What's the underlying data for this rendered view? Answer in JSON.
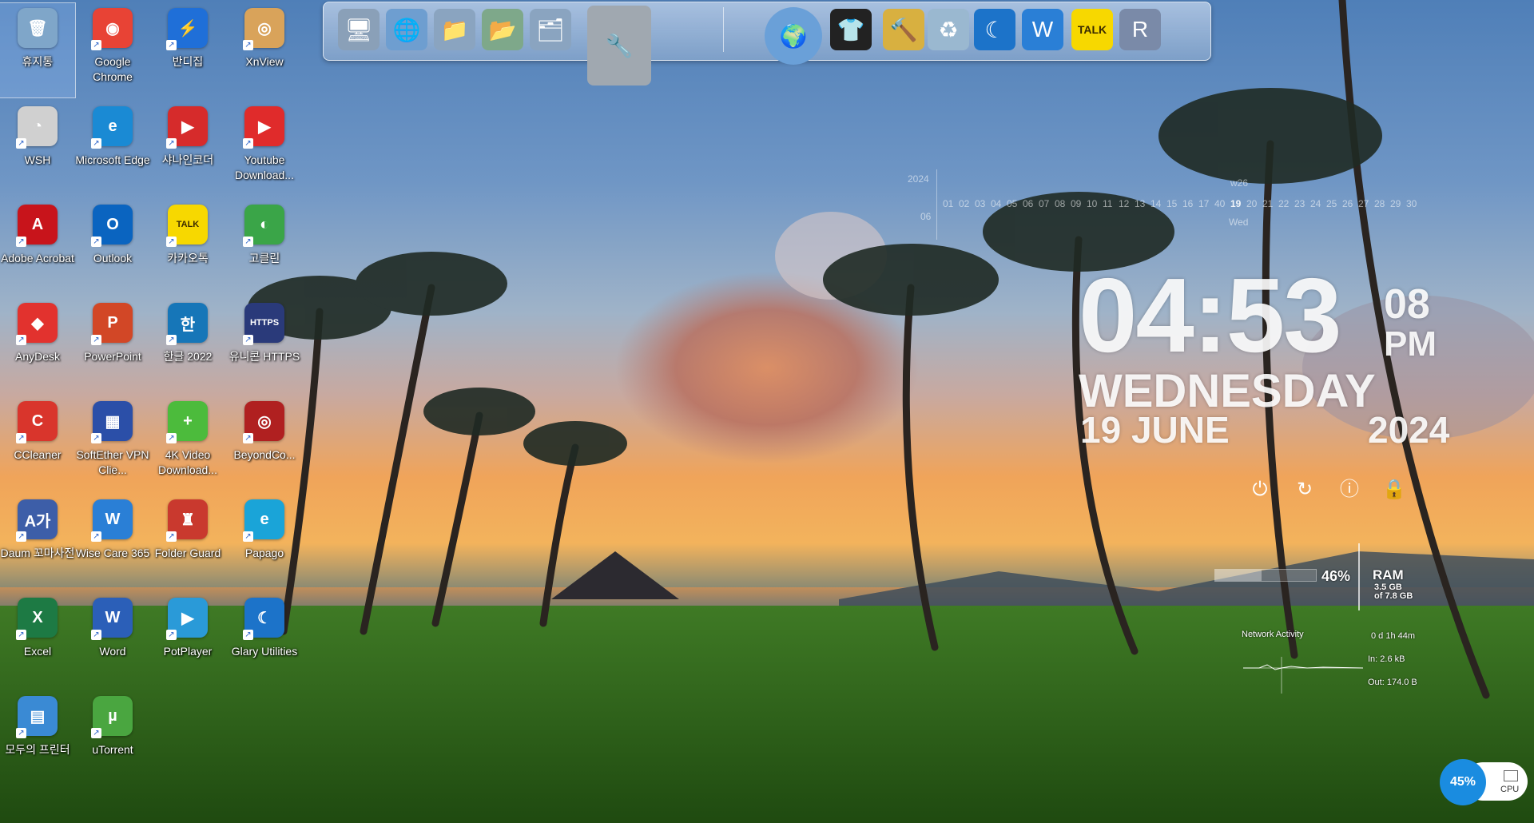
{
  "desktop": {
    "icons": [
      {
        "label": "휴지통",
        "color": "#7fa6c9",
        "glyph": "🗑"
      },
      {
        "label": "Google Chrome",
        "color": "#e84335",
        "glyph": "◉"
      },
      {
        "label": "반디집",
        "color": "#1f6fd8",
        "glyph": "⚡"
      },
      {
        "label": "XnView",
        "color": "#d9a35a",
        "glyph": "◎"
      },
      {
        "label": "WSH",
        "color": "#d0d0d0",
        "glyph": "◔"
      },
      {
        "label": "Microsoft Edge",
        "color": "#1a8ad4",
        "glyph": "e"
      },
      {
        "label": "샤나인코더",
        "color": "#d62b2b",
        "glyph": "▶"
      },
      {
        "label": "Youtube Download...",
        "color": "#e02b2b",
        "glyph": "▶"
      },
      {
        "label": "Adobe Acrobat",
        "color": "#c8141b",
        "glyph": "A"
      },
      {
        "label": "Outlook",
        "color": "#0a64c0",
        "glyph": "O"
      },
      {
        "label": "카카오톡",
        "color": "#f7d800",
        "glyph": "TALK"
      },
      {
        "label": "고클린",
        "color": "#3aa548",
        "glyph": "◐"
      },
      {
        "label": "AnyDesk",
        "color": "#e2322e",
        "glyph": "◆"
      },
      {
        "label": "PowerPoint",
        "color": "#d24726",
        "glyph": "P"
      },
      {
        "label": "한글 2022",
        "color": "#1676b8",
        "glyph": "한"
      },
      {
        "label": "유니콘 HTTPS",
        "color": "#2a3a7a",
        "glyph": "HTTPS"
      },
      {
        "label": "CCleaner",
        "color": "#d9352c",
        "glyph": "C"
      },
      {
        "label": "SoftEther VPN Clie...",
        "color": "#2b4fa8",
        "glyph": "▦"
      },
      {
        "label": "4K Video Download...",
        "color": "#4cbb3c",
        "glyph": "+"
      },
      {
        "label": "BeyondCo...",
        "color": "#b02020",
        "glyph": "◎"
      },
      {
        "label": "Daum 꼬마사전",
        "color": "#3d5ea8",
        "glyph": "A가"
      },
      {
        "label": "Wise Care 365",
        "color": "#2a7fd6",
        "glyph": "W"
      },
      {
        "label": "Folder Guard",
        "color": "#c9392e",
        "glyph": "♜"
      },
      {
        "label": "Papago",
        "color": "#1aa4d8",
        "glyph": "e"
      },
      {
        "label": "Excel",
        "color": "#1d7a44",
        "glyph": "X"
      },
      {
        "label": "Word",
        "color": "#2b5fb8",
        "glyph": "W"
      },
      {
        "label": "PotPlayer",
        "color": "#2a9ad8",
        "glyph": "▶"
      },
      {
        "label": "Glary Utilities",
        "color": "#1c73c9",
        "glyph": "☾"
      },
      {
        "label": "모두의 프린터",
        "color": "#3a8ad4",
        "glyph": "▤"
      },
      {
        "label": "uTorrent",
        "color": "#4aa640",
        "glyph": "µ"
      }
    ]
  },
  "dock": {
    "items": [
      {
        "name": "computer-icon",
        "glyph": "🖥",
        "color": "#8aa0b8"
      },
      {
        "name": "network-icon",
        "glyph": "🌐",
        "color": "#6e9ed0"
      },
      {
        "name": "folder-icon",
        "glyph": "📁",
        "color": "#8aa4c0"
      },
      {
        "name": "folder-green-icon",
        "glyph": "📂",
        "color": "#7ea88a"
      },
      {
        "name": "folder-open-icon",
        "glyph": "🗂",
        "color": "#8aa4c0"
      },
      {
        "name": "tools-icon",
        "glyph": "🔧",
        "color": "#a0a8b0"
      },
      {
        "name": "globe-icon",
        "glyph": "🌍",
        "color": "#6aa0d8"
      },
      {
        "name": "tshirt-icon",
        "glyph": "👕",
        "color": "#222222"
      },
      {
        "name": "hammer-icon",
        "glyph": "🔨",
        "color": "#d8b040"
      },
      {
        "name": "recycle-bin-icon",
        "glyph": "♻",
        "color": "#9ab8d0"
      },
      {
        "name": "glary-icon",
        "glyph": "☾",
        "color": "#1c73c9"
      },
      {
        "name": "wise-icon",
        "glyph": "W",
        "color": "#2a7fd6"
      },
      {
        "name": "kakaotalk-icon",
        "glyph": "TALK",
        "color": "#f7d800"
      },
      {
        "name": "registry-icon",
        "glyph": "R",
        "color": "#7a8aa8"
      }
    ]
  },
  "calendar": {
    "year": "2024",
    "month": "06",
    "week": "w26",
    "days": [
      "01",
      "02",
      "03",
      "04",
      "05",
      "06",
      "07",
      "08",
      "09",
      "10",
      "11",
      "12",
      "13",
      "14",
      "15",
      "16",
      "17",
      "40",
      "19",
      "20",
      "21",
      "22",
      "23",
      "24",
      "25",
      "26",
      "27",
      "28",
      "29",
      "30"
    ],
    "today_index": 18,
    "today_name": "Wed"
  },
  "clock": {
    "time": "04:53",
    "seconds": "08",
    "ampm": "PM",
    "weekday": "WEDNESDAY",
    "date": "19 JUNE",
    "year": "2024"
  },
  "controls": [
    {
      "name": "power-icon",
      "glyph": "⏻"
    },
    {
      "name": "restart-icon",
      "glyph": "↻"
    },
    {
      "name": "info-icon",
      "glyph": "ⓘ"
    },
    {
      "name": "lock-icon",
      "glyph": "🔒"
    }
  ],
  "ram": {
    "percent": "46%",
    "label": "RAM",
    "used": "3.5 GB",
    "total": "of 7.8 GB",
    "fill": 0.46
  },
  "network": {
    "title": "Network Activity",
    "uptime": "0 d 1h 44m",
    "in": "In: 2.6 kB",
    "out": "Out: 174.0 B"
  },
  "cpu": {
    "percent": "45%",
    "label": "CPU"
  }
}
